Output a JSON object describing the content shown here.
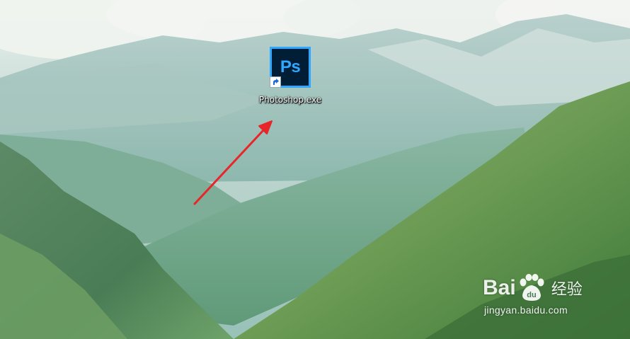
{
  "desktop": {
    "icons": [
      {
        "label": "Photoshop.exe",
        "icon_text": "Ps",
        "icon_name": "photoshop-app-icon",
        "shortcut_overlay": "shortcut-arrow-icon",
        "colors": {
          "tile": "#001e36",
          "accent": "#31a8ff"
        }
      }
    ]
  },
  "annotation": {
    "type": "arrow",
    "color": "#e8262a"
  },
  "watermark": {
    "brand_left": "Bai",
    "brand_right": "经验",
    "brand_mid_icon": "baidu-paw-du-icon",
    "brand_mid": "du",
    "url": "jingyan.baidu.com"
  }
}
